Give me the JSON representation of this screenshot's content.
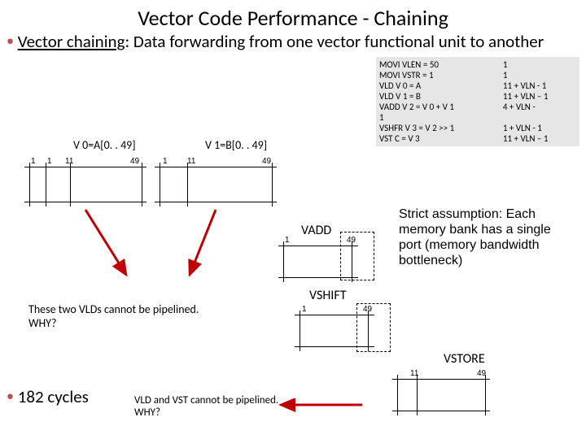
{
  "title": "Vector Code Performance - Chaining",
  "bullet1": {
    "pre": "Vector chaining",
    "post": ": Data forwarding from one vector functional unit to another"
  },
  "code": [
    {
      "l": "MOVI VLEN = 50",
      "r": "1"
    },
    {
      "l": "MOVI VSTR = 1",
      "r": "1"
    },
    {
      "l": "VLD V 0 = A",
      "r": "11 + VLN - 1"
    },
    {
      "l": "VLD V 1 = B",
      "r": "11 + VLN – 1"
    },
    {
      "l": "VADD V 2 = V 0 + V 1",
      "r": "4 + VLN -"
    },
    {
      "l": "1",
      "r": ""
    },
    {
      "l": "VSHFR V 3 = V 2 >> 1",
      "r": "1 + VLN - 1"
    },
    {
      "l": "VST C = V 3",
      "r": "11 + VLN – 1"
    }
  ],
  "reg": {
    "v0": "V 0=A[0. . 49]",
    "v1": "V 1=B[0. . 49]"
  },
  "ops": {
    "vadd": "VADD",
    "vshift": "VSHIFT",
    "vstore": "VSTORE"
  },
  "ticks": {
    "1a": "1",
    "1b": "1",
    "11a": "11",
    "11b": "11",
    "49a": "49",
    "49b": "49",
    "1c": "1",
    "49c": "49",
    "1d": "1",
    "49d": "49",
    "11e": "11",
    "49e": "49"
  },
  "note1": "These two VLDs cannot be pipelined. WHY?",
  "assumption": "Strict assumption: Each memory bank has a single port (memory bandwidth bottleneck)",
  "cycles": "182 cycles",
  "note2": "VLD and VST cannot be pipelined. WHY?"
}
